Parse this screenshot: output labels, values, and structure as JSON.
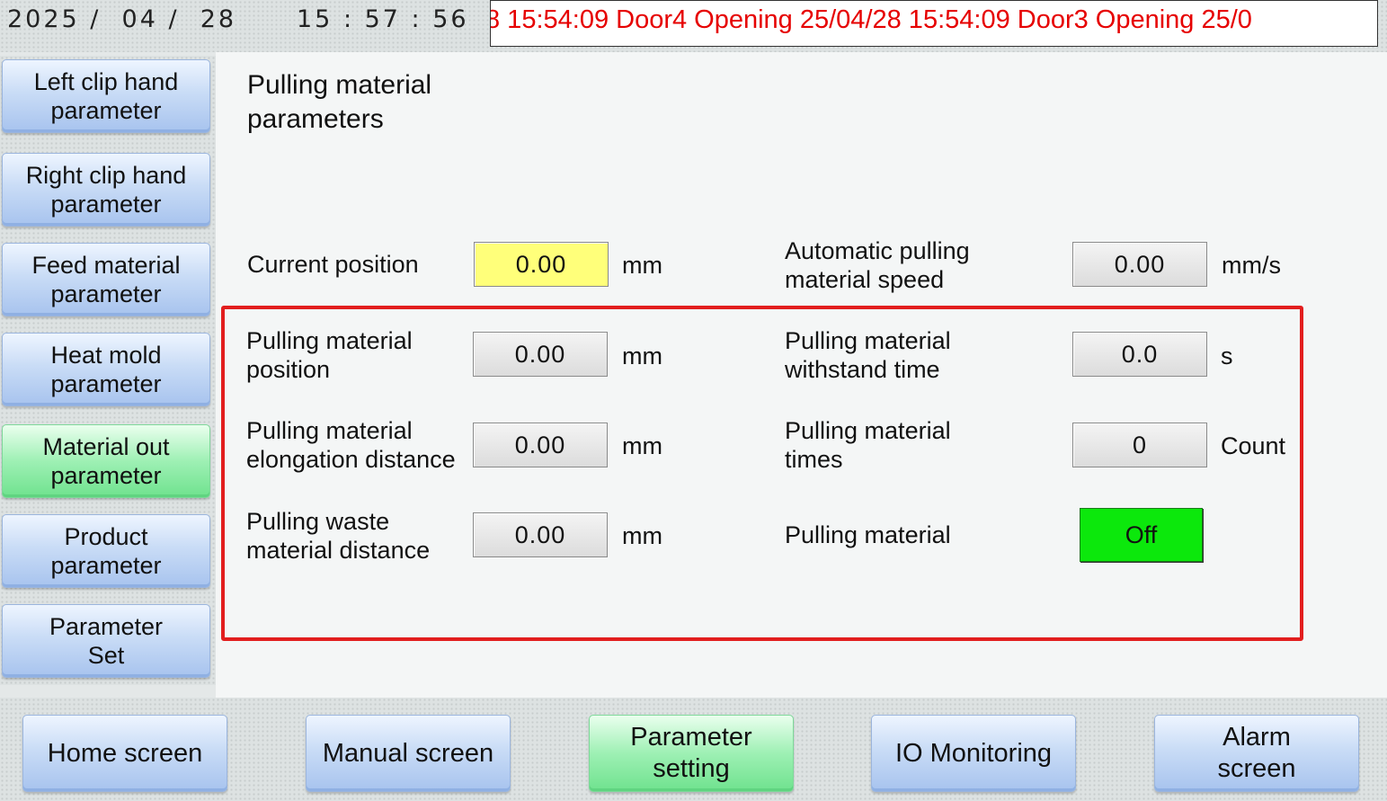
{
  "topbar": {
    "date": "2025 /  04 /  28",
    "time": "15 : 57 : 56",
    "ticker": "8  15:54:09  Door4 Opening  25/04/28  15:54:09  Door3 Opening  25/0"
  },
  "sidebar": {
    "items": [
      {
        "label": "Left clip hand\nparameter"
      },
      {
        "label": "Right clip hand\nparameter"
      },
      {
        "label": "Feed material\nparameter"
      },
      {
        "label": "Heat mold\nparameter"
      },
      {
        "label": "Material out\nparameter"
      },
      {
        "label": "Product\nparameter"
      },
      {
        "label": "Parameter\nSet"
      }
    ]
  },
  "main": {
    "title": "Pulling material\nparameters",
    "current_position": {
      "label": "Current position",
      "value": "0.00",
      "unit": "mm"
    },
    "auto_speed": {
      "label": "Automatic pulling\nmaterial speed",
      "value": "0.00",
      "unit": "mm/s"
    },
    "position": {
      "label": "Pulling material\nposition",
      "value": "0.00",
      "unit": "mm"
    },
    "withstand_time": {
      "label": "Pulling material\nwithstand time",
      "value": "0.0",
      "unit": "s"
    },
    "elongation": {
      "label": "Pulling material\nelongation distance",
      "value": "0.00",
      "unit": "mm"
    },
    "times": {
      "label": "Pulling material\ntimes",
      "value": "0",
      "unit": "Count"
    },
    "waste_distance": {
      "label": "Pulling waste\nmaterial distance",
      "value": "0.00",
      "unit": "mm"
    },
    "switch": {
      "label": "Pulling material",
      "state": "Off"
    }
  },
  "nav": {
    "items": [
      {
        "label": "Home screen"
      },
      {
        "label": "Manual screen"
      },
      {
        "label": "Parameter\nsetting"
      },
      {
        "label": "IO Monitoring"
      },
      {
        "label": "Alarm\nscreen"
      }
    ]
  },
  "colors": {
    "accent_active": "#6fe28e",
    "button_blue": "#a7c3ee",
    "highlight_yellow": "#ffff7a",
    "ticker_red": "#e60000",
    "frame_red": "#e21e1e",
    "toggle_green": "#0ce80c"
  }
}
